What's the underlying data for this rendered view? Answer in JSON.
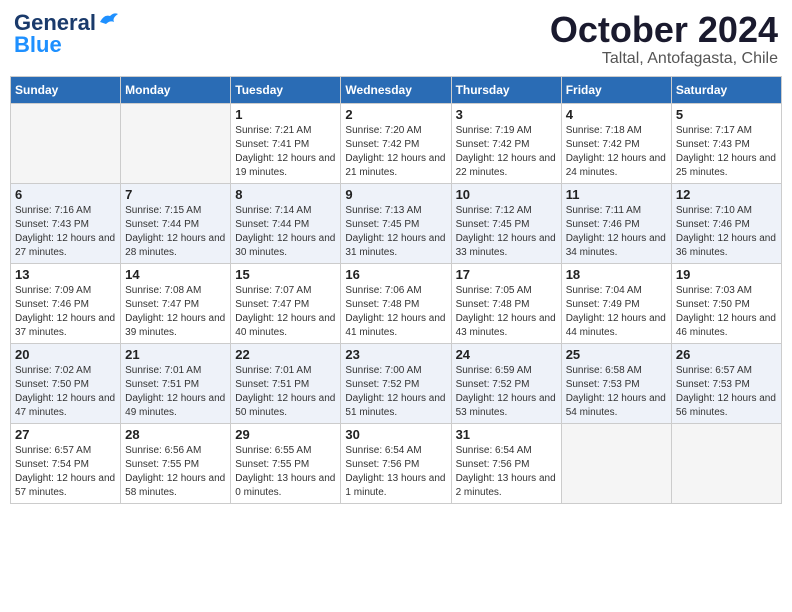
{
  "header": {
    "logo_general": "General",
    "logo_blue": "Blue",
    "month_title": "October 2024",
    "location": "Taltal, Antofagasta, Chile"
  },
  "days_of_week": [
    "Sunday",
    "Monday",
    "Tuesday",
    "Wednesday",
    "Thursday",
    "Friday",
    "Saturday"
  ],
  "weeks": [
    [
      {
        "day": "",
        "info": ""
      },
      {
        "day": "",
        "info": ""
      },
      {
        "day": "1",
        "info": "Sunrise: 7:21 AM\nSunset: 7:41 PM\nDaylight: 12 hours\nand 19 minutes."
      },
      {
        "day": "2",
        "info": "Sunrise: 7:20 AM\nSunset: 7:42 PM\nDaylight: 12 hours\nand 21 minutes."
      },
      {
        "day": "3",
        "info": "Sunrise: 7:19 AM\nSunset: 7:42 PM\nDaylight: 12 hours\nand 22 minutes."
      },
      {
        "day": "4",
        "info": "Sunrise: 7:18 AM\nSunset: 7:42 PM\nDaylight: 12 hours\nand 24 minutes."
      },
      {
        "day": "5",
        "info": "Sunrise: 7:17 AM\nSunset: 7:43 PM\nDaylight: 12 hours\nand 25 minutes."
      }
    ],
    [
      {
        "day": "6",
        "info": "Sunrise: 7:16 AM\nSunset: 7:43 PM\nDaylight: 12 hours\nand 27 minutes."
      },
      {
        "day": "7",
        "info": "Sunrise: 7:15 AM\nSunset: 7:44 PM\nDaylight: 12 hours\nand 28 minutes."
      },
      {
        "day": "8",
        "info": "Sunrise: 7:14 AM\nSunset: 7:44 PM\nDaylight: 12 hours\nand 30 minutes."
      },
      {
        "day": "9",
        "info": "Sunrise: 7:13 AM\nSunset: 7:45 PM\nDaylight: 12 hours\nand 31 minutes."
      },
      {
        "day": "10",
        "info": "Sunrise: 7:12 AM\nSunset: 7:45 PM\nDaylight: 12 hours\nand 33 minutes."
      },
      {
        "day": "11",
        "info": "Sunrise: 7:11 AM\nSunset: 7:46 PM\nDaylight: 12 hours\nand 34 minutes."
      },
      {
        "day": "12",
        "info": "Sunrise: 7:10 AM\nSunset: 7:46 PM\nDaylight: 12 hours\nand 36 minutes."
      }
    ],
    [
      {
        "day": "13",
        "info": "Sunrise: 7:09 AM\nSunset: 7:46 PM\nDaylight: 12 hours\nand 37 minutes."
      },
      {
        "day": "14",
        "info": "Sunrise: 7:08 AM\nSunset: 7:47 PM\nDaylight: 12 hours\nand 39 minutes."
      },
      {
        "day": "15",
        "info": "Sunrise: 7:07 AM\nSunset: 7:47 PM\nDaylight: 12 hours\nand 40 minutes."
      },
      {
        "day": "16",
        "info": "Sunrise: 7:06 AM\nSunset: 7:48 PM\nDaylight: 12 hours\nand 41 minutes."
      },
      {
        "day": "17",
        "info": "Sunrise: 7:05 AM\nSunset: 7:48 PM\nDaylight: 12 hours\nand 43 minutes."
      },
      {
        "day": "18",
        "info": "Sunrise: 7:04 AM\nSunset: 7:49 PM\nDaylight: 12 hours\nand 44 minutes."
      },
      {
        "day": "19",
        "info": "Sunrise: 7:03 AM\nSunset: 7:50 PM\nDaylight: 12 hours\nand 46 minutes."
      }
    ],
    [
      {
        "day": "20",
        "info": "Sunrise: 7:02 AM\nSunset: 7:50 PM\nDaylight: 12 hours\nand 47 minutes."
      },
      {
        "day": "21",
        "info": "Sunrise: 7:01 AM\nSunset: 7:51 PM\nDaylight: 12 hours\nand 49 minutes."
      },
      {
        "day": "22",
        "info": "Sunrise: 7:01 AM\nSunset: 7:51 PM\nDaylight: 12 hours\nand 50 minutes."
      },
      {
        "day": "23",
        "info": "Sunrise: 7:00 AM\nSunset: 7:52 PM\nDaylight: 12 hours\nand 51 minutes."
      },
      {
        "day": "24",
        "info": "Sunrise: 6:59 AM\nSunset: 7:52 PM\nDaylight: 12 hours\nand 53 minutes."
      },
      {
        "day": "25",
        "info": "Sunrise: 6:58 AM\nSunset: 7:53 PM\nDaylight: 12 hours\nand 54 minutes."
      },
      {
        "day": "26",
        "info": "Sunrise: 6:57 AM\nSunset: 7:53 PM\nDaylight: 12 hours\nand 56 minutes."
      }
    ],
    [
      {
        "day": "27",
        "info": "Sunrise: 6:57 AM\nSunset: 7:54 PM\nDaylight: 12 hours\nand 57 minutes."
      },
      {
        "day": "28",
        "info": "Sunrise: 6:56 AM\nSunset: 7:55 PM\nDaylight: 12 hours\nand 58 minutes."
      },
      {
        "day": "29",
        "info": "Sunrise: 6:55 AM\nSunset: 7:55 PM\nDaylight: 13 hours\nand 0 minutes."
      },
      {
        "day": "30",
        "info": "Sunrise: 6:54 AM\nSunset: 7:56 PM\nDaylight: 13 hours\nand 1 minute."
      },
      {
        "day": "31",
        "info": "Sunrise: 6:54 AM\nSunset: 7:56 PM\nDaylight: 13 hours\nand 2 minutes."
      },
      {
        "day": "",
        "info": ""
      },
      {
        "day": "",
        "info": ""
      }
    ]
  ]
}
